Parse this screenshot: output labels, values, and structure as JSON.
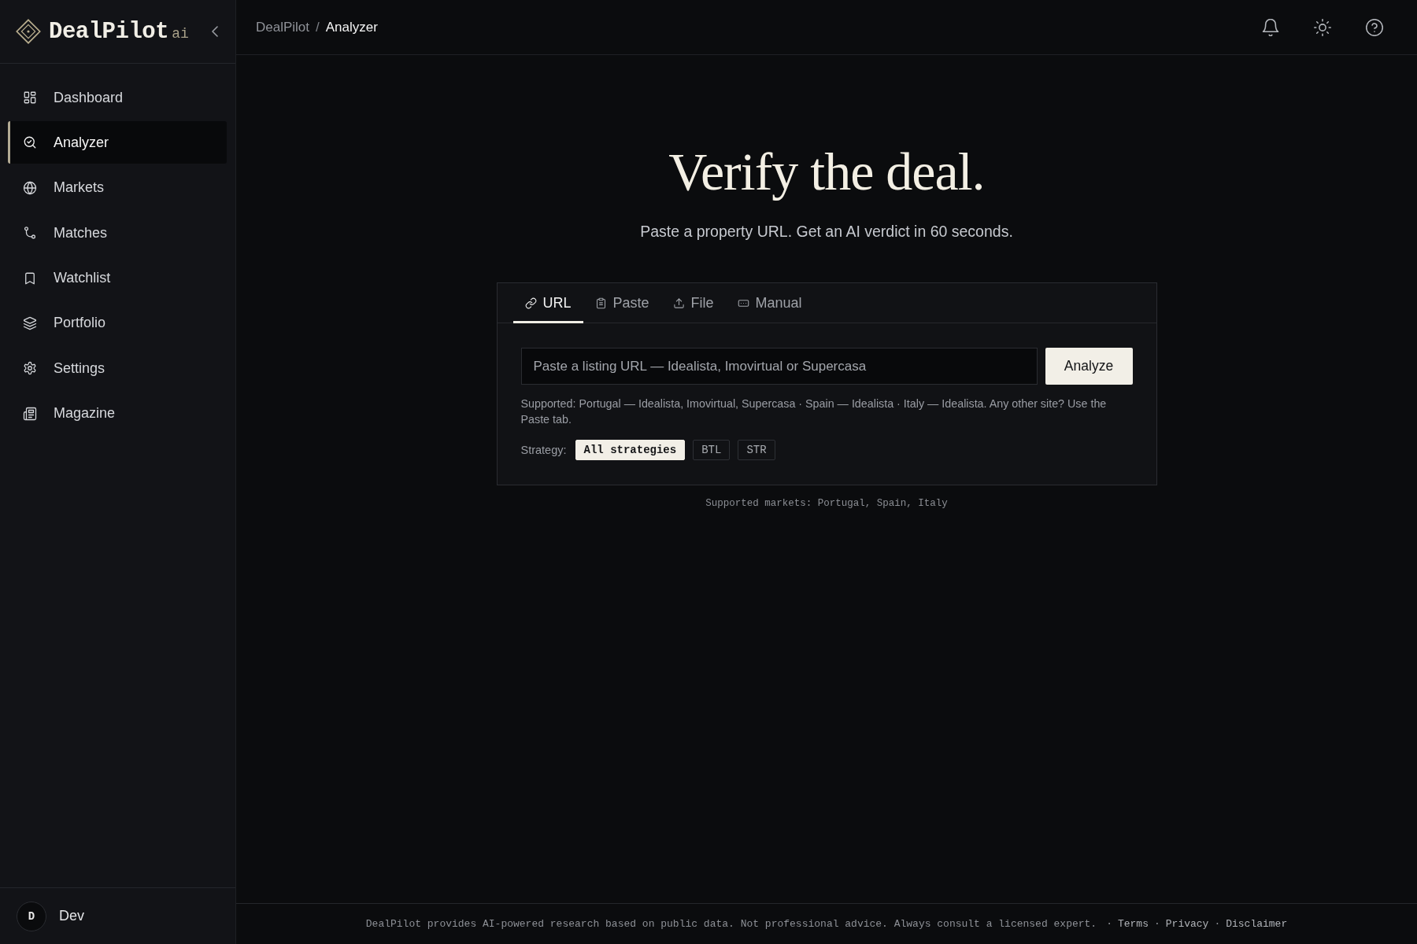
{
  "sidebar": {
    "logo": {
      "name": "DealPilot",
      "suffix": "ai"
    },
    "items": [
      {
        "label": "Dashboard",
        "selected": false
      },
      {
        "label": "Analyzer",
        "selected": true
      },
      {
        "label": "Markets",
        "selected": false
      },
      {
        "label": "Matches",
        "selected": false
      },
      {
        "label": "Watchlist",
        "selected": false
      },
      {
        "label": "Portfolio",
        "selected": false
      },
      {
        "label": "Settings",
        "selected": false
      },
      {
        "label": "Magazine",
        "selected": false
      }
    ],
    "user": {
      "initial": "D",
      "name": "Dev"
    }
  },
  "topbar": {
    "breadcrumb": {
      "items": [
        {
          "label": "DealPilot",
          "current": false
        },
        {
          "label": "Analyzer",
          "current": true
        }
      ],
      "separator": "/"
    }
  },
  "hero": {
    "title": "Verify the deal.",
    "subtitle": "Paste a property URL. Get an AI verdict in 60 seconds."
  },
  "input_card": {
    "tabs": [
      {
        "label": "URL",
        "selected": true
      },
      {
        "label": "Paste",
        "selected": false
      },
      {
        "label": "File",
        "selected": false
      },
      {
        "label": "Manual",
        "selected": false
      }
    ],
    "url_field": {
      "placeholder": "Paste a listing URL — Idealista, Imovirtual or Supercasa"
    },
    "submit": "Analyze",
    "help": "Supported: Portugal — Idealista, Imovirtual, Supercasa · Spain — Idealista · Italy — Idealista. Any other site? Use the Paste tab.",
    "strategy": {
      "label": "Strategy:",
      "options": [
        {
          "label": "All strategies",
          "selected": true
        },
        {
          "label": "BTL",
          "selected": false
        },
        {
          "label": "STR",
          "selected": false
        }
      ]
    }
  },
  "markets_note": "Supported markets: Portugal, Spain, Italy",
  "footer": {
    "disclaimer": "DealPilot provides AI-powered research based on public data. Not professional advice. Always consult a licensed expert.",
    "links": [
      {
        "separator": "·",
        "label": "Terms"
      },
      {
        "separator": "·",
        "label": "Privacy"
      },
      {
        "separator": "·",
        "label": "Disclaimer"
      }
    ]
  }
}
